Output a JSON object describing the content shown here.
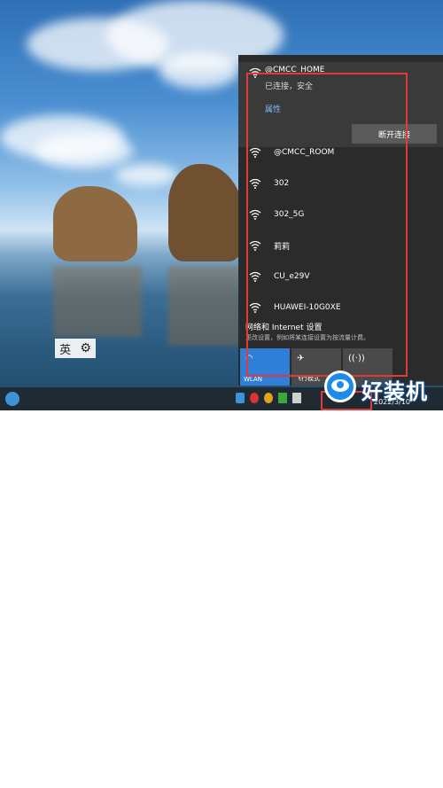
{
  "ime": {
    "lang": "英",
    "gear_icon": "gear-icon"
  },
  "network": {
    "current": {
      "ssid": "@CMCC_HOME",
      "status": "已连接，安全",
      "properties": "属性",
      "disconnect": "断开连接"
    },
    "list": [
      {
        "ssid": "@CMCC_ROOM"
      },
      {
        "ssid": "302"
      },
      {
        "ssid": "302_5G"
      },
      {
        "ssid": "莉莉"
      },
      {
        "ssid": "CU_e29V"
      },
      {
        "ssid": "HUAWEI-10G0XE"
      }
    ],
    "settings_title": "网络和 Internet 设置",
    "settings_desc": "更改设置，例如将某连接设置为按流量计费。",
    "tiles": [
      {
        "label": "WLAN",
        "icon": "wifi-icon"
      },
      {
        "label": "飞行模式",
        "icon": "airplane-icon"
      },
      {
        "label": "",
        "icon": "hotspot-icon"
      }
    ]
  },
  "taskbar": {
    "date": "2022/3/10"
  },
  "watermark": {
    "text": "好装机"
  },
  "colors": {
    "flyout_bg": "#2b2b2b",
    "accent": "#2f7fd8",
    "highlight": "#e03a3a"
  }
}
